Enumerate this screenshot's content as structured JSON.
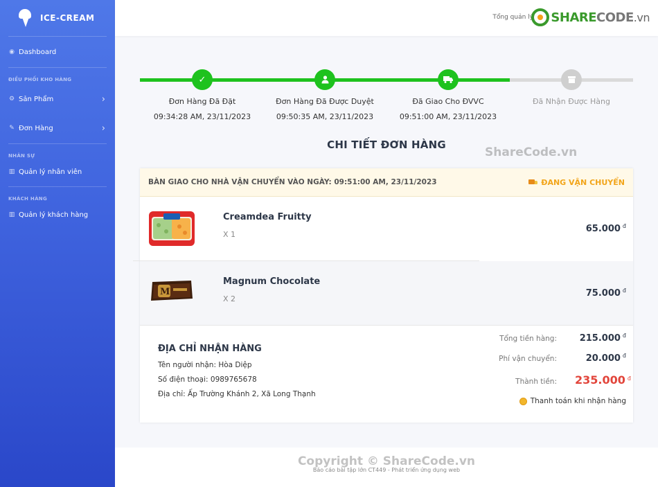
{
  "brand": {
    "name": "ICE-CREAM"
  },
  "sidebar": {
    "dashboard": "Dashboard",
    "section_inventory": "ĐIỀU PHỐI KHO HÀNG",
    "products": "Sản Phẩm",
    "orders": "Đơn Hàng",
    "section_hr": "NHÂN SỰ",
    "staff": "Quản lý nhân viên",
    "section_customers": "KHÁCH HÀNG",
    "customers": "Quản lý khách hàng"
  },
  "header": {
    "admin_label": "Tổng quản lý",
    "logo": {
      "share": "SHARE",
      "code": "CODE",
      "vn": ".vn"
    }
  },
  "progress": {
    "fill_fraction": 0.75,
    "steps": [
      {
        "label": "Đơn Hàng Đã Đặt",
        "time": "09:34:28 AM, 23/11/2023",
        "icon": "check-icon",
        "done": true
      },
      {
        "label": "Đơn Hàng Đã Được Duyệt",
        "time": "09:50:35 AM, 23/11/2023",
        "icon": "user-icon",
        "done": true
      },
      {
        "label": "Đã Giao Cho ĐVVC",
        "time": "09:51:00 AM, 23/11/2023",
        "icon": "truck-icon",
        "done": true
      },
      {
        "label": "Đã Nhận Được Hàng",
        "time": "",
        "icon": "box-icon",
        "done": false
      }
    ]
  },
  "page_title": "CHI TIẾT ĐƠN HÀNG",
  "watermark": "ShareCode.vn",
  "order": {
    "handover_text": "BÀN GIAO CHO NHÀ VẬN CHUYỂN VÀO NGÀY: 09:51:00 AM, 23/11/2023",
    "status": "ĐANG VẬN CHUYỂN",
    "items": [
      {
        "name": "Creamdea Fruitty",
        "qty": "X 1",
        "price": "65.000",
        "currency": "đ"
      },
      {
        "name": "Magnum Chocolate",
        "qty": "X 2",
        "price": "75.000",
        "currency": "đ"
      }
    ],
    "address": {
      "title": "ĐỊA CHỈ NHẬN HÀNG",
      "recipient": "Tên người nhận: Hòa Diệp",
      "phone": "Số điện thoại: 0989765678",
      "address": "Địa chỉ: Ấp Trường Khánh 2, Xã Long Thạnh"
    },
    "summary": {
      "subtotal_label": "Tổng tiền hàng:",
      "subtotal": "215.000",
      "shipping_label": "Phí vận chuyển:",
      "shipping": "20.000",
      "total_label": "Thành tiền:",
      "total": "235.000",
      "currency": "đ",
      "payment": "Thanh toán khi nhận hàng"
    }
  },
  "footer": {
    "copyright_wm": "Copyright © ShareCode.vn",
    "text": "Báo cáo bài tập lớn CT449 - Phát triển ứng dụng web"
  },
  "colors": {
    "sidebar": "#3f63de",
    "success": "#1ec21e",
    "warning": "#f2a51a",
    "total": "#e2453b"
  }
}
